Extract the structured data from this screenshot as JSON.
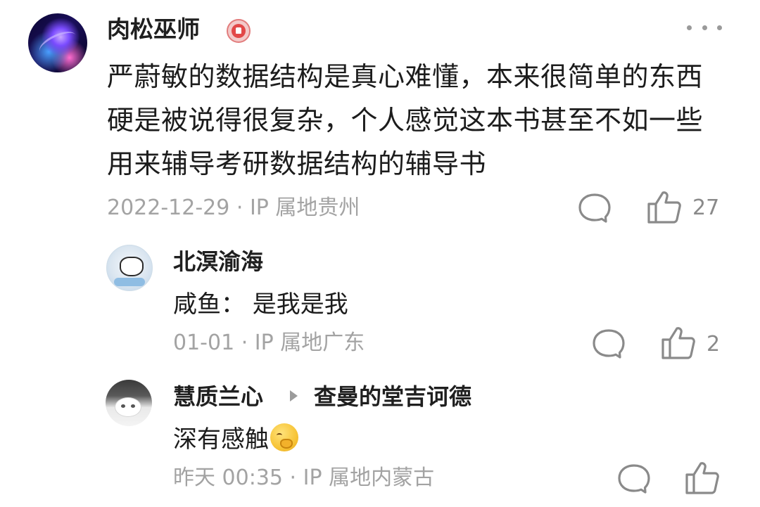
{
  "main_comment": {
    "author": "肉松巫师",
    "text": "严蔚敏的数据结构是真心难懂，本来很简单的东西硬是被说得很复杂，个人感觉这本书甚至不如一些用来辅导考研数据结构的辅导书",
    "meta": "2022-12-29 · IP 属地贵州",
    "like_count": "27",
    "icons": [
      "badge-icon",
      "more-icon",
      "comment-icon",
      "like-icon"
    ]
  },
  "replies": [
    {
      "author": "北溟渝海",
      "text": "咸鱼：  是我是我",
      "meta": "01-01 · IP 属地广东",
      "like_count": "2"
    },
    {
      "author": "慧质兰心",
      "reply_to": "查曼的堂吉诃德",
      "text": "深有感触",
      "emoji": "smiling-face-with-hand-over-mouth",
      "meta": "昨天 00:35 · IP 属地内蒙古",
      "like_count": ""
    }
  ],
  "colors": {
    "text_primary": "#1c1c1c",
    "text_meta": "#a3a3a3",
    "icon_gray": "#8a8a8a",
    "badge_red": "#e24848"
  }
}
